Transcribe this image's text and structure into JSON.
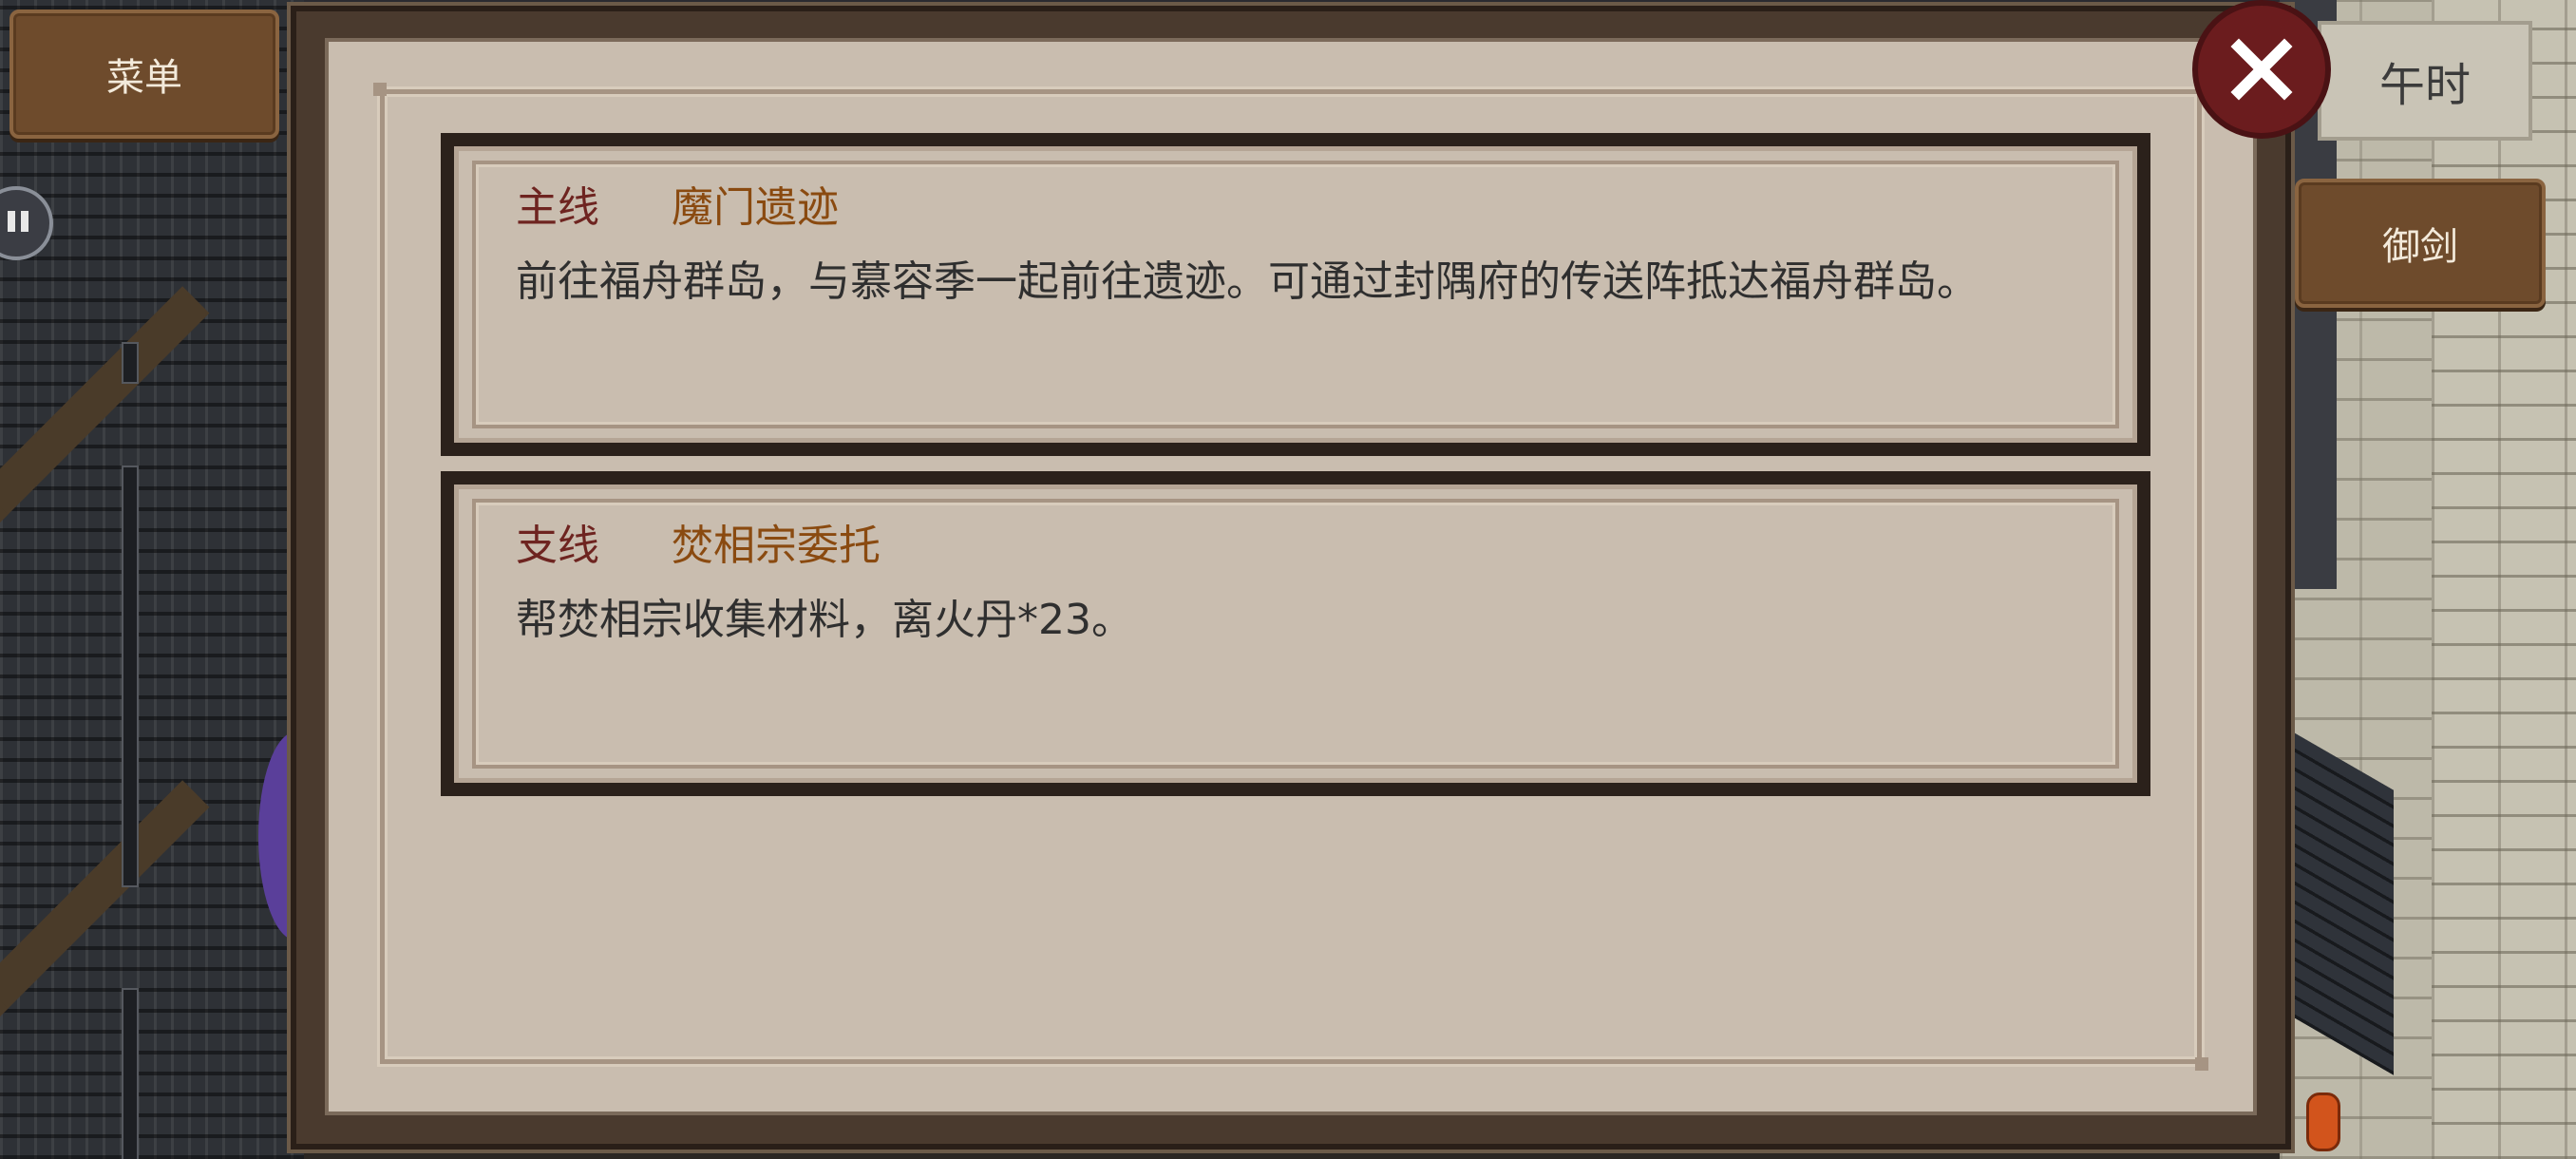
{
  "menu": {
    "label": "菜单"
  },
  "time": {
    "label": "午时"
  },
  "actions": {
    "sword_label": "御剑"
  },
  "quests": [
    {
      "type": "主线",
      "title": "魔门遗迹",
      "description": "前往福舟群岛，与慕容季一起前往遗迹。可通过封隅府的传送阵抵达福舟群岛。"
    },
    {
      "type": "支线",
      "title": "焚相宗委托",
      "description": "帮焚相宗收集材料，离火丹*23。"
    }
  ],
  "icons": {
    "close": "close-icon",
    "side": "pause-icon"
  },
  "colors": {
    "quest_type": "#6e2420",
    "quest_title": "#8a4a10",
    "close_button": "#6b1c1e",
    "button_brown": "#6e4b2c"
  }
}
